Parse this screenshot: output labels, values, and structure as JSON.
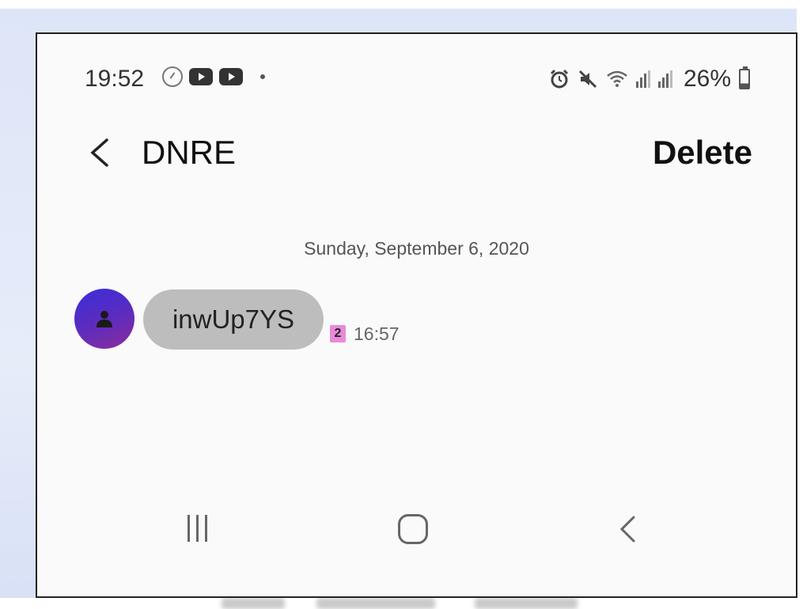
{
  "status_bar": {
    "time": "19:52",
    "icons_left": [
      "data-saver-icon",
      "youtube-icon",
      "youtube-icon",
      "dot-icon"
    ],
    "icons_right": [
      "alarm-icon",
      "mute-icon",
      "wifi-icon",
      "signal-icon",
      "signal-icon"
    ],
    "battery": "26%",
    "battery_level": 0.26
  },
  "header": {
    "title": "DNRE",
    "action_label": "Delete"
  },
  "conversation": {
    "date_label": "Sunday, September 6, 2020",
    "messages": [
      {
        "text": "inwUp7YS",
        "sim_slot": "2",
        "time": "16:57"
      }
    ]
  },
  "nav_bar": {
    "buttons": [
      "recents",
      "home",
      "back"
    ]
  },
  "colors": {
    "avatar_start": "#3a2ed8",
    "avatar_end": "#8a2c9c",
    "bubble": "#bdbdbd",
    "sim_badge": "#e88ad8"
  }
}
